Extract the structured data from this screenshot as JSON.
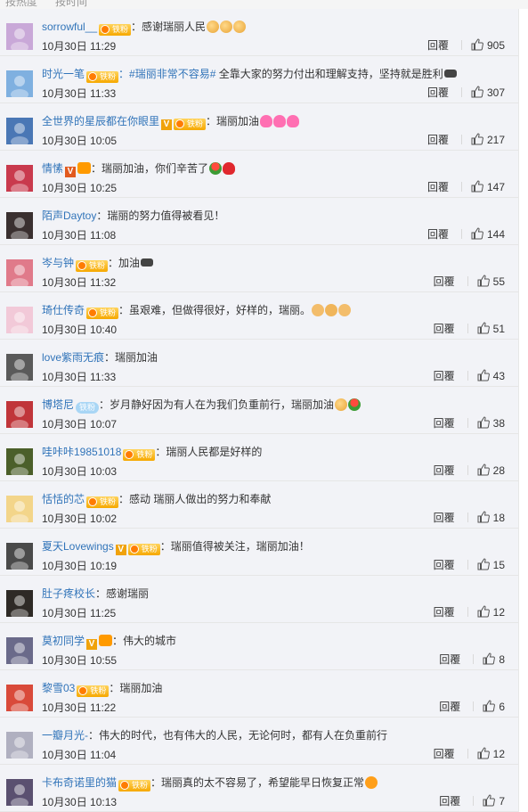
{
  "top_tabs": [
    "按热度",
    "按时间"
  ],
  "reply_label": "回覆",
  "comments": [
    {
      "name": "sorrowful__",
      "badges": [
        "fan"
      ],
      "topic": "",
      "text": "：感谢瑞丽人民",
      "emojis": [
        "thumb",
        "thumb",
        "thumb"
      ],
      "time": "10月30日 11:29",
      "likes": "905",
      "avatar_color": "#c9a8d8"
    },
    {
      "name": "时光一笔",
      "badges": [
        "fan"
      ],
      "topic": "：#瑞丽非常不容易#",
      "text": " 全靠大家的努力付出和理解支持，坚持就是胜利",
      "emojis": [
        "bicep"
      ],
      "time": "10月30日 11:33",
      "likes": "307",
      "avatar_color": "#7fb0e0"
    },
    {
      "name": "全世界的星辰都在你眼里",
      "badges": [
        "v",
        "fan"
      ],
      "topic": "",
      "text": "：瑞丽加油",
      "emojis": [
        "pinkheart",
        "pinkheart",
        "pinkheart"
      ],
      "time": "10月30日 10:05",
      "likes": "217",
      "avatar_color": "#4a77b5"
    },
    {
      "name": "情愫",
      "badges": [
        "v-red",
        "crown"
      ],
      "topic": "",
      "text": "：瑞丽加油，你们辛苦了",
      "emojis": [
        "rose",
        "heart"
      ],
      "time": "10月30日 10:25",
      "likes": "147",
      "avatar_color": "#c93a4d"
    },
    {
      "name": "陌声Daytoy",
      "badges": [],
      "topic": "",
      "text": "：瑞丽的努力值得被看见！",
      "emojis": [],
      "time": "10月30日 11:08",
      "likes": "144",
      "avatar_color": "#3a3030"
    },
    {
      "name": "岑与钟",
      "badges": [
        "fan"
      ],
      "topic": "",
      "text": "：加油",
      "emojis": [
        "bicep"
      ],
      "time": "10月30日 11:32",
      "likes": "55",
      "avatar_color": "#e07a8a"
    },
    {
      "name": "琦仕传奇",
      "badges": [
        "fan"
      ],
      "topic": "",
      "text": "：虽艰难，但做得很好，好样的，瑞丽。",
      "emojis": [
        "muscle",
        "clap",
        "muscle"
      ],
      "time": "10月30日 10:40",
      "likes": "51",
      "avatar_color": "#f2c9d8"
    },
    {
      "name": "love紫雨无痕",
      "badges": [],
      "topic": "",
      "text": "：瑞丽加油",
      "emojis": [],
      "time": "10月30日 11:33",
      "likes": "43",
      "avatar_color": "#5a5a5a"
    },
    {
      "name": "博塔尼",
      "badges": [
        "iron"
      ],
      "topic": "",
      "text": "：岁月静好因为有人在为我们负重前行，瑞丽加油",
      "emojis": [
        "thumb",
        "rose"
      ],
      "time": "10月30日 10:07",
      "likes": "38",
      "avatar_color": "#c0353a"
    },
    {
      "name": "哇咔咔19851018",
      "badges": [
        "fan"
      ],
      "topic": "",
      "text": "：瑞丽人民都是好样的",
      "emojis": [],
      "time": "10月30日 10:03",
      "likes": "28",
      "avatar_color": "#4b5f2a"
    },
    {
      "name": "恬恬的芯",
      "badges": [
        "fan"
      ],
      "topic": "",
      "text": "：感动 瑞丽人做出的努力和奉献",
      "emojis": [],
      "time": "10月30日 10:02",
      "likes": "18",
      "avatar_color": "#f3d58a"
    },
    {
      "name": "夏天Lovewings",
      "badges": [
        "v",
        "fan"
      ],
      "topic": "",
      "text": "：瑞丽值得被关注，瑞丽加油！",
      "emojis": [],
      "time": "10月30日 10:19",
      "likes": "15",
      "avatar_color": "#4a4a4a"
    },
    {
      "name": "肚子疼校长",
      "badges": [],
      "topic": "",
      "text": "：感谢瑞丽",
      "emojis": [],
      "time": "10月30日 11:25",
      "likes": "12",
      "avatar_color": "#2e2a26"
    },
    {
      "name": "莫初同学",
      "badges": [
        "v",
        "crown"
      ],
      "topic": "",
      "text": "：伟大的城市",
      "emojis": [],
      "time": "10月30日 10:55",
      "likes": "8",
      "avatar_color": "#6a6a8a"
    },
    {
      "name": "黎雪03",
      "badges": [
        "fan"
      ],
      "topic": "",
      "text": "：瑞丽加油",
      "emojis": [],
      "time": "10月30日 11:22",
      "likes": "6",
      "avatar_color": "#d94a3a"
    },
    {
      "name": "一瓣月光-",
      "badges": [],
      "topic": "",
      "text": "：伟大的时代，也有伟大的人民，无论何时，都有人在负重前行",
      "emojis": [],
      "time": "10月30日 11:04",
      "likes": "12",
      "avatar_color": "#b0b0c0"
    },
    {
      "name": "卡布奇诺里的猫",
      "badges": [
        "fan"
      ],
      "topic": "",
      "text": "：瑞丽真的太不容易了，希望能早日恢复正常",
      "emojis": [
        "wink"
      ],
      "time": "10月30日 10:13",
      "likes": "7",
      "avatar_color": "#5a5070"
    }
  ]
}
